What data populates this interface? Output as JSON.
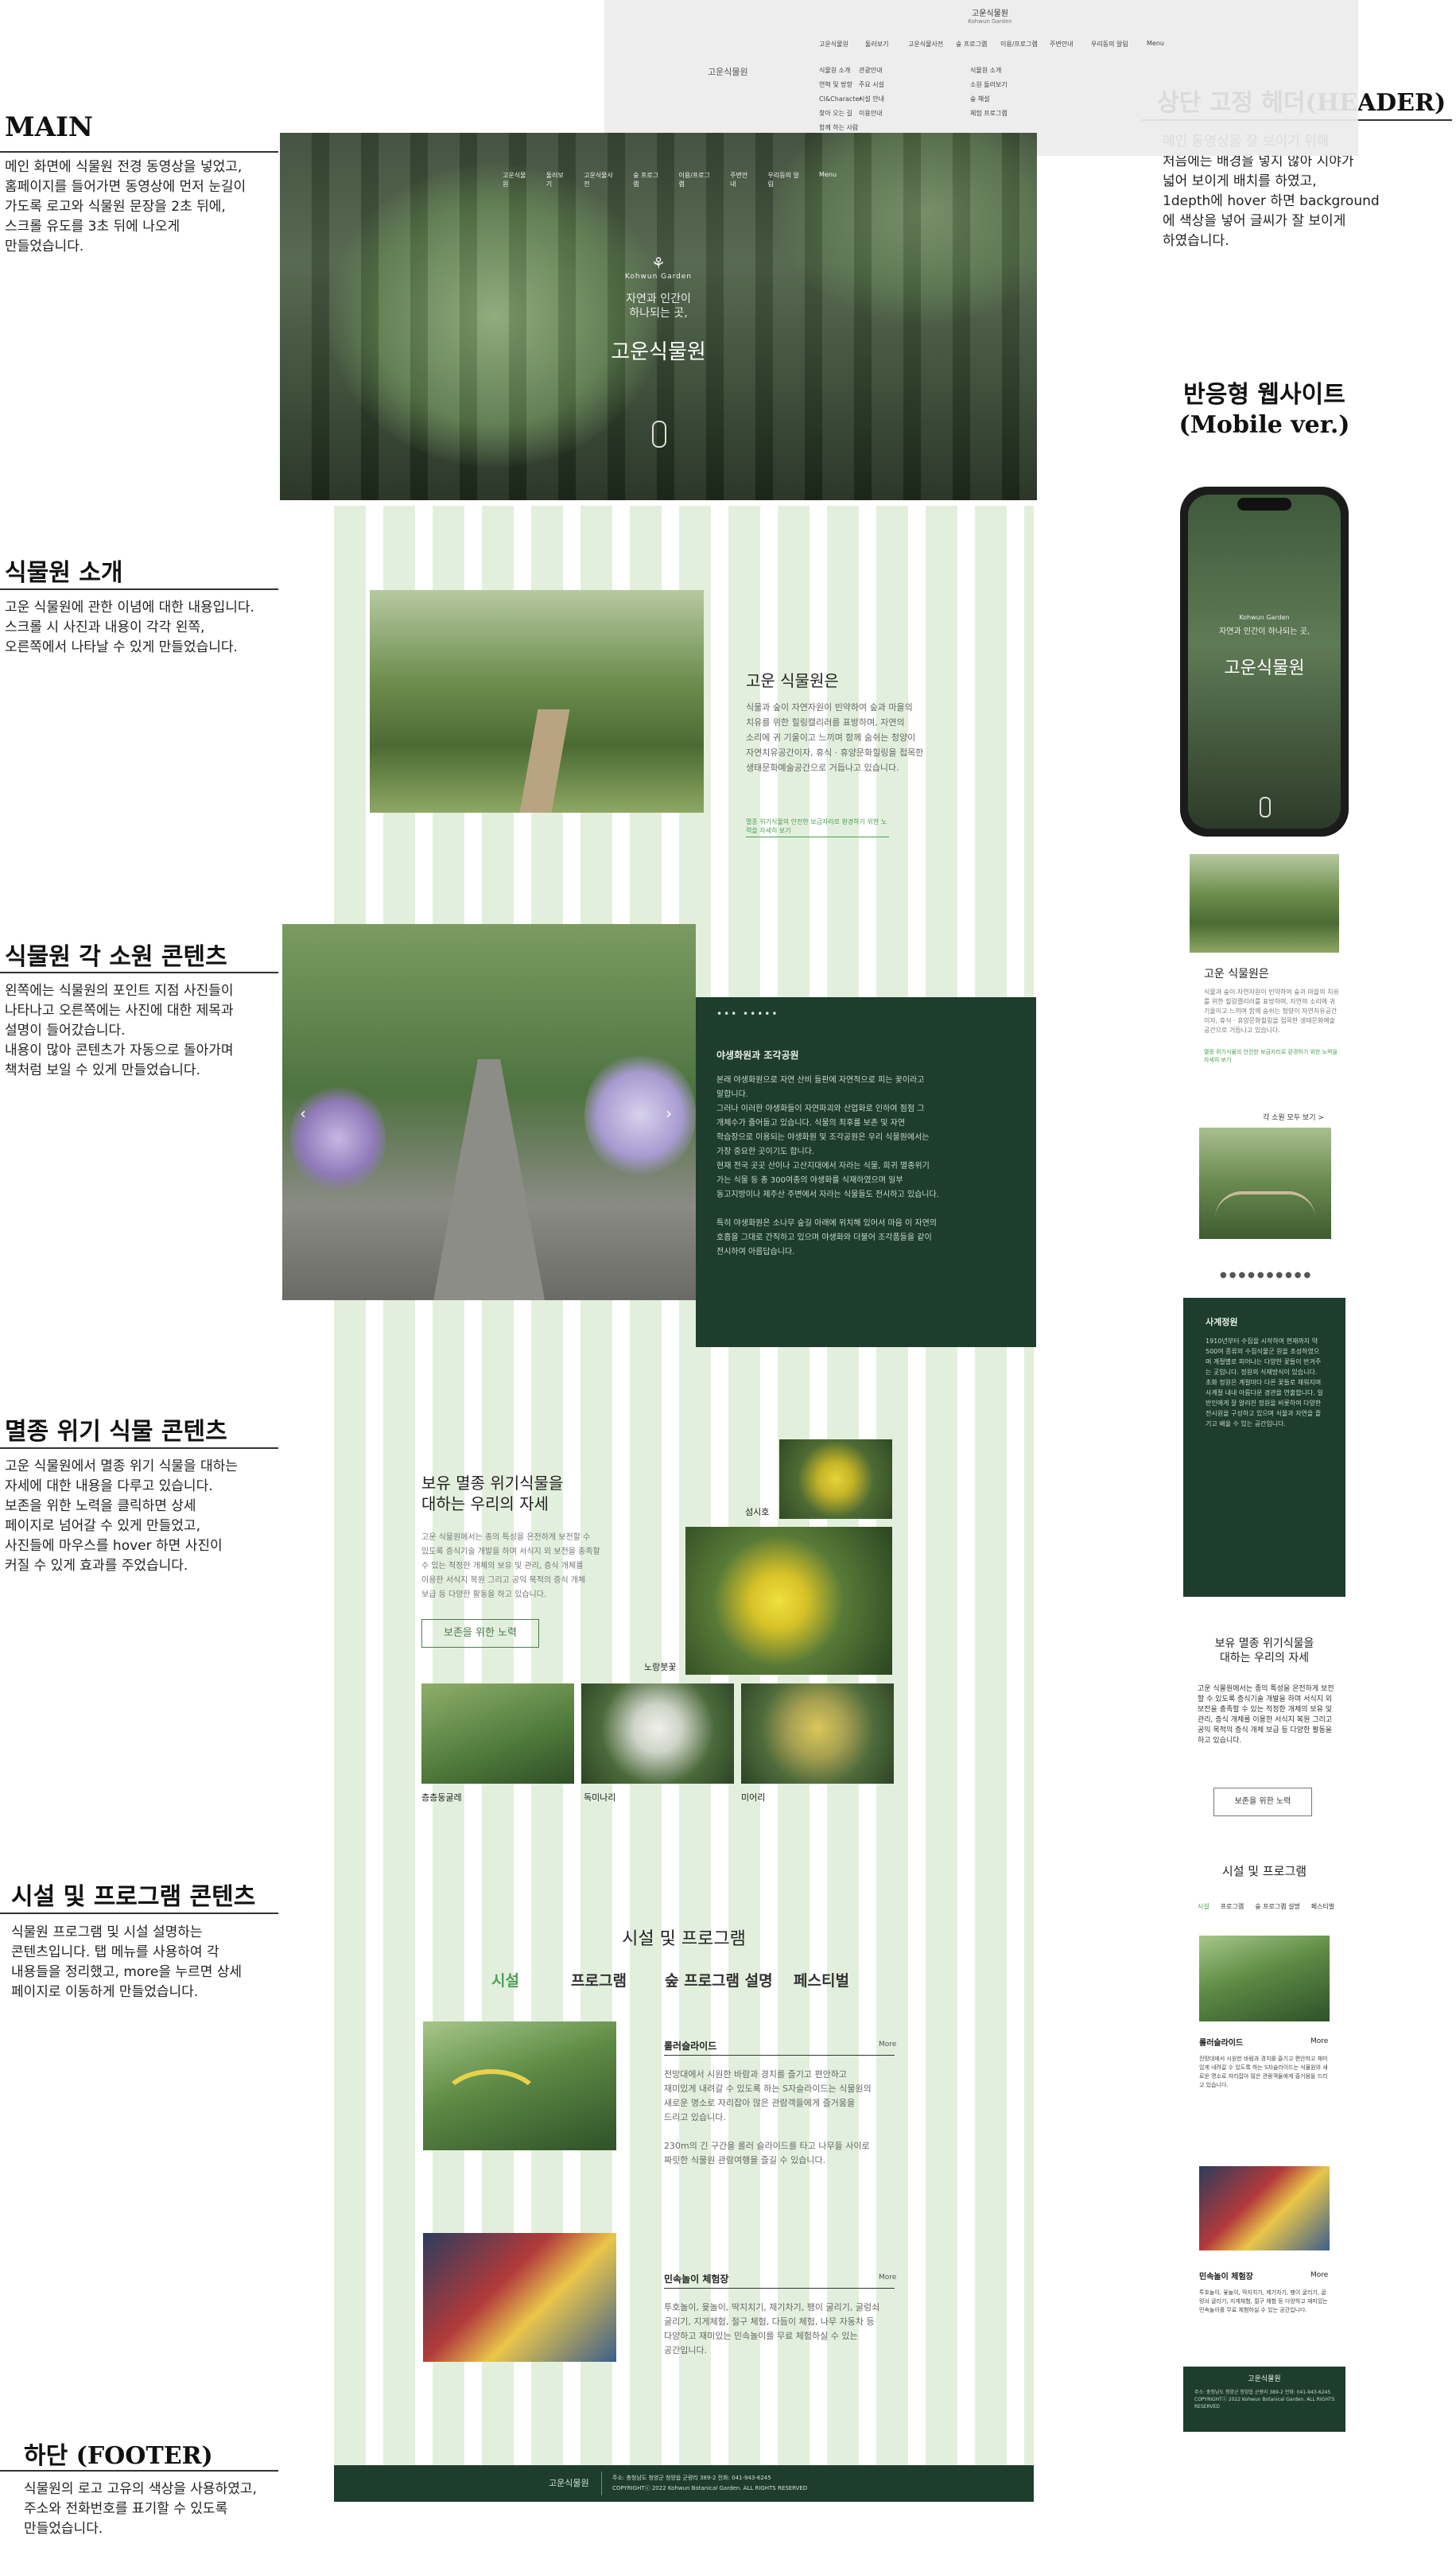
{
  "annotations": {
    "main": {
      "title": "MAIN",
      "text": [
        "메인 화면에 식물원 전경 동영상을 넣었고,",
        "홈페이지를 들어가면 동영상에 먼저 눈길이",
        "가도록 로고와 식물원 문장을 2초 뒤에,",
        "스크롤 유도를 3초 뒤에 나오게",
        "만들었습니다."
      ]
    },
    "header": {
      "title": "상단 고정 헤더(HEADER)",
      "text": [
        "메인 동영상을 잘 보이기 위해",
        "처음에는 배경을 넣지 않아 시야가",
        "넓어 보이게 배치를 하였고,",
        "1depth에 hover 하면 background",
        "에 색상을 넣어 글씨가 잘 보이게",
        "하였습니다."
      ]
    },
    "responsive": {
      "title_line1": "반응형 웹사이트",
      "title_line2": "(Mobile ver.)"
    },
    "intro": {
      "title": "식물원 소개",
      "text": [
        "고운 식물원에 관한 이념에 대한 내용입니다.",
        "스크롤 시 사진과 내용이 각각 왼쪽,",
        "오른쪽에서 나타날 수 있게 만들었습니다."
      ]
    },
    "gardens": {
      "title": "식물원 각 소원 콘텐츠",
      "text": [
        "왼쪽에는 식물원의 포인트 지점 사진들이",
        "나타나고 오른쪽에는 사진에 대한 제목과",
        "설명이 들어갔습니다.",
        "내용이 많아 콘텐츠가 자동으로 돌아가며",
        "책처럼 보일 수 있게 만들었습니다."
      ]
    },
    "endangered": {
      "title": "멸종 위기 식물 콘텐츠",
      "text": [
        "고운 식물원에서 멸종 위기 식물을 대하는",
        "자세에 대한 내용을 다루고 있습니다.",
        "보존을 위한 노력을 클릭하면 상세",
        "페이지로 넘어갈 수 있게 만들었고,",
        "사진들에 마우스를 hover 하면 사진이",
        "커질 수 있게 효과를 주었습니다."
      ]
    },
    "facilities": {
      "title": "시설 및 프로그램 콘텐츠",
      "text": [
        "식물원 프로그램 및 시설 설명하는",
        "콘텐츠입니다. 탭 메뉴를 사용하여 각",
        "내용들을 정리했고, more을 누르면 상세",
        "페이지로 이동하게 만들었습니다."
      ]
    },
    "footer": {
      "title": "하단 (FOOTER)",
      "text": [
        "식물원의 로고 고유의 색상을 사용하였고,",
        "주소와 전화번호를 표기할 수 있도록",
        "만들었습니다."
      ]
    }
  },
  "header_mock": {
    "logo_small": "고운식물원",
    "logo_sub": "Kohwun Garden",
    "menu": [
      "고운식물원",
      "둘러보기",
      "고운식물사전",
      "숲 프로그램",
      "이용/프로그램",
      "주변안내",
      "우리동의 알림",
      "Menu"
    ],
    "submenu_col1": [
      "식물원 소개",
      "연혁 및 방향",
      "CI&Character",
      "찾아 오는 길",
      "함께 하는 사람"
    ],
    "submenu_col2": [
      "관광안내",
      "주요 시설",
      "시설 안내",
      "이용안내"
    ],
    "submenu_col3": [
      "식물원 소개",
      "소원 둘러보기",
      "숲 해설",
      "체험 프로그램"
    ],
    "left_logo": "고운식물원"
  },
  "hero": {
    "nav": [
      "고운식물원",
      "둘러보기",
      "고운식물사전",
      "숲 프로그램",
      "이용/프로그램",
      "주변안내",
      "우리동의 알림",
      "Menu"
    ],
    "logo_en": "Kohwun Garden",
    "slogan_line1": "자연과 인간이",
    "slogan_line2": "하나되는 곳,",
    "title": "고운식물원"
  },
  "intro": {
    "heading": "고운 식물원은",
    "body": [
      "식물과 숲이 자연자원이 빈약하여 숲과 마을의",
      "치유를 위한 힐링캘리러를 표방하며, 자연의",
      "소리에 귀 기울이고 느끼며 함께 숨쉬는 청양이",
      "자연치유공간이자, 휴식 · 휴양문화힐링을 접목한",
      "생태문화예술공간으로 거듭나고 있습니다."
    ],
    "link_text": "멸종 위기식물의 안전한 보금자리로 환경하기 위한 노력을 자세히 보기"
  },
  "gardens_panel": {
    "dots": "••• •••••",
    "heading": "야생화원과 조각공원",
    "body": [
      "본래 야생화원으로 자연 산비 들판에 자연적으로 피는 꽃이라고",
      "말합니다.",
      "그러나 이러한 야생화들이 자연파괴와 산업화로 인하여 점점 그",
      "개체수가 줄어들고 있습니다. 식물의 최후를 보존 및 자연",
      "학습장으로 이용되는 야생화원 및 조각공원은 우리 식물원에서는",
      "가장 중요한 곳이기도 합니다.",
      "현재 전국 곳곳 산이나 고산지대에서 자라는 식물, 희귀 멸종위기",
      "가는 식물 등 총 300여종의 야생화를 식재하였으며 일부",
      "동고지방이나 제주산 주변에서 자라는 식물들도 전시하고 있습니다.",
      "",
      "특히 야생화원은 소나무 숲길 아래에 위치해 있어서 마음 이 자연의",
      "호흡을 그대로 간직하고 있으며 야생화와 더불어 조각품들을 같이",
      "전시하여 아름답습니다."
    ]
  },
  "endangered": {
    "heading_line1": "보유 멸종 위기식물을",
    "heading_line2": "대하는 우리의 자세",
    "body": [
      "고운 식물원에서는 종의 특성을 온전하게 보전할 수",
      "있도록 증식기술 개발을 하며 서식지 외 보전을 충족할",
      "수 있는 적정한 개체의 보유 및 관리, 증식 개체를",
      "이용한 서식지 복원 그리고 공익 목적의 증식 개체",
      "보급 등 다양한 활동을 하고 있습니다."
    ],
    "button": "보존을 위한 노력",
    "labels": [
      "섬시호",
      "노랑붓꽃",
      "층층둥굴레",
      "독미나리",
      "미어리"
    ]
  },
  "facilities": {
    "heading": "시설 및 프로그램",
    "tabs": [
      "시설",
      "프로그램",
      "숲 프로그램 설명",
      "페스티벌"
    ],
    "item1": {
      "title": "롤러슬라이드",
      "more": "More",
      "body": [
        "전망대에서 시원한 바람과 경치를 즐기고 편안하고",
        "재미있게 내려갈 수 있도록 하는 S자슬라이드는 식물원의",
        "새로운 명소로 자리잡아 많은 관람객들에게 즐거움을",
        "드리고 있습니다.",
        "",
        "230m의 긴 구간을 롤러 슬라이드를 타고 나무들 사이로",
        "짜릿한 식물원 관람여행을 즐길 수 있습니다."
      ]
    },
    "item2": {
      "title": "민속놀이 체험장",
      "more": "More",
      "body": [
        "투호놀이, 윷놀이, 딱지치기, 제기차기, 팽이 굴리기, 굴렁쇠",
        "굴리기, 지게체험, 절구 체험, 다듬이 체험, 나무 자동차 등",
        "다양하고 재미있는 민속놀이를 무료 체험하실 수 있는",
        "공간입니다."
      ]
    }
  },
  "footer": {
    "logo": "고운식물원",
    "info": [
      "주소: 충청남도 청양군 청양읍 군량리 389-2   전화: 041-943-6245",
      "COPYRIGHTⓒ 2022 Kohwun Botanical Garden. ALL RIGHTS RESERVED"
    ]
  },
  "mobile": {
    "hero_logo": "Kohwun Garden",
    "hero_slogan": "자연과 인간이 하나되는 곳,",
    "hero_title": "고운식물원",
    "intro_heading": "고운 식물원은",
    "intro_body": "식물과 숲이 자연자원이 빈약하여 숲과 마을의 치유를 위한 힐링캘리러를 표방하며, 자연의 소리에 귀 기울이고 느끼며 함께 숨쉬는 청양이 자연치유공간이자, 휴식 · 휴양문화힐링을 접목한 생태문화예술공간으로 거듭나고 있습니다.",
    "intro_link": "멸종 위기식물의 안전한 보금자리로 환경하기 위한 노력을 자세히 보기",
    "gardens_link": "각 소원 모두 보기 >",
    "panel_heading": "사계정원",
    "panel_body": "1910년부터 수집을 시작하여 현재까지 약 500여 종류의 수집식물군 원을 조성하였으며 계절별로 피어나는 다양한 꽃들이 반겨주는 곳입니다. 정원의 식재방식이 있습니다. 초화 정원은 계절마다 다른 꽃들로 채워지며 사계절 내내 아름다운 경관을 연출합니다. 일반인에게 잘 알려진 정원을 비롯하여 다양한 전시원을 구성하고 있으며 식물과 자연을 즐기고 배울 수 있는 공간입니다.",
    "endangered_heading_line1": "보유 멸종 위기식물을",
    "endangered_heading_line2": "대하는 우리의 자세",
    "endangered_body": "고운 식물원에서는 종의 특성을 온전하게 보전할 수 있도록 증식기술 개발을 하며 서식지 외 보전을 충족할 수 있는 적정한 개체의 보유 및 관리, 증식 개체를 이용한 서식지 복원 그리고 공익 목적의 증식 개체 보급 등 다양한 활동을 하고 있습니다.",
    "endangered_button": "보존을 위한 노력",
    "facilities_heading": "시설 및 프로그램",
    "facilities_tabs": [
      "시설",
      "프로그램",
      "숲 프로그램 설명",
      "페스티벌"
    ],
    "item1_title": "롤러슬라이드",
    "item1_body": "전망대에서 시원한 바람과 경치를 즐기고 편안하고 재미있게 내려갈 수 있도록 하는 S자슬라이드는 식물원의 새로운 명소로 자리잡아 많은 관람객들에게 즐거움을 드리고 있습니다.",
    "item2_title": "민속놀이 체험장",
    "item2_body": "투호놀이, 윷놀이, 딱지치기, 제기차기, 팽이 굴리기, 굴렁쇠 굴리기, 지게체험, 절구 체험 등 다양하고 재미있는 민속놀이를 무료 체험하실 수 있는 공간입니다.",
    "more": "More",
    "footer_logo": "고운식물원",
    "footer_text": "주소: 충청남도 청양군 청양읍 군량리 389-2 전화: 041-943-6245 COPYRIGHTⓒ 2022 Kohwun Botanical Garden. ALL RIGHTS RESERVED"
  },
  "colors": {
    "dark_green": "#1e3d2d",
    "accent_green": "#4b9e51",
    "grid_green": "#e3efdd"
  }
}
